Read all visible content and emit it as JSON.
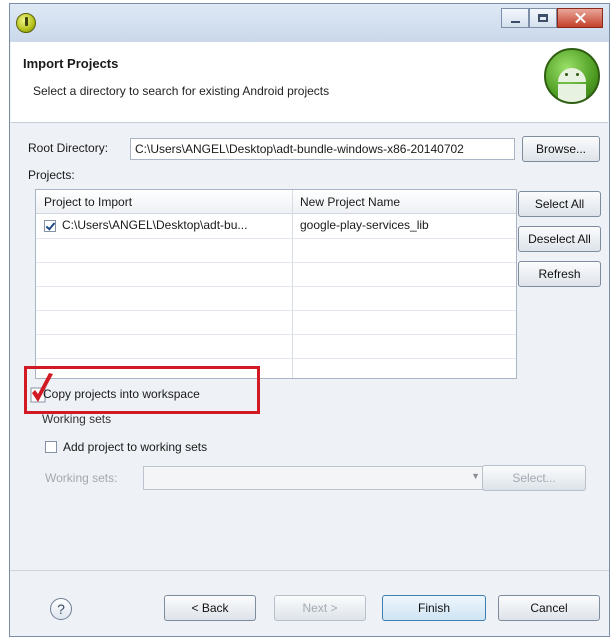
{
  "window": {
    "icon": "eclipse-app-icon",
    "controls": [
      "minimize-icon",
      "maximize-icon",
      "close-icon"
    ]
  },
  "header": {
    "title": "Import Projects",
    "description": "Select a directory to search for existing Android projects",
    "logo": "android-logo"
  },
  "root": {
    "label": "Root Directory:",
    "value": "C:\\Users\\ANGEL\\Desktop\\adt-bundle-windows-x86-20140702",
    "browse_label": "Browse..."
  },
  "projects": {
    "label": "Projects:",
    "columns": [
      "Project to Import",
      "New Project Name"
    ],
    "rows": [
      {
        "checked": true,
        "project": "C:\\Users\\ANGEL\\Desktop\\adt-bu...",
        "new_name": "google-play-services_lib"
      }
    ],
    "select_all": "Select All",
    "deselect_all": "Deselect All",
    "refresh": "Refresh"
  },
  "copy": {
    "label": "Copy projects into workspace",
    "checked": true,
    "highlight_color": "#d21a24"
  },
  "working_sets": {
    "group_label": "Working sets",
    "add_label": "Add project to working sets",
    "sets_label": "Working sets:",
    "select_label": "Select..."
  },
  "footer": {
    "help": "?",
    "back": "< Back",
    "next": "Next >",
    "finish": "Finish",
    "cancel": "Cancel"
  }
}
